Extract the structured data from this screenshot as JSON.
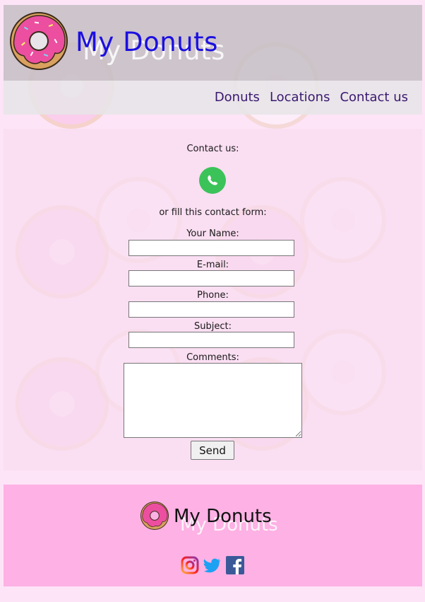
{
  "header": {
    "title": "My Donuts",
    "nav": [
      "Donuts",
      "Locations",
      "Contact us"
    ]
  },
  "contact": {
    "heading": "Contact us:",
    "alt_text": "or fill this contact form:",
    "fields": {
      "name_label": "Your Name:",
      "email_label": "E-mail:",
      "phone_label": "Phone:",
      "subject_label": "Subject:",
      "comments_label": "Comments:"
    },
    "send_label": "Send"
  },
  "footer": {
    "title": "My Donuts",
    "social": [
      "instagram-icon",
      "twitter-icon",
      "facebook-icon"
    ]
  },
  "colors": {
    "title_blue": "#1b0fe0",
    "nav_purple": "#3a1870",
    "footer_pink": "#fdb1e4",
    "page_bg": "#fde4f7",
    "whatsapp_green": "#3bc35a"
  }
}
